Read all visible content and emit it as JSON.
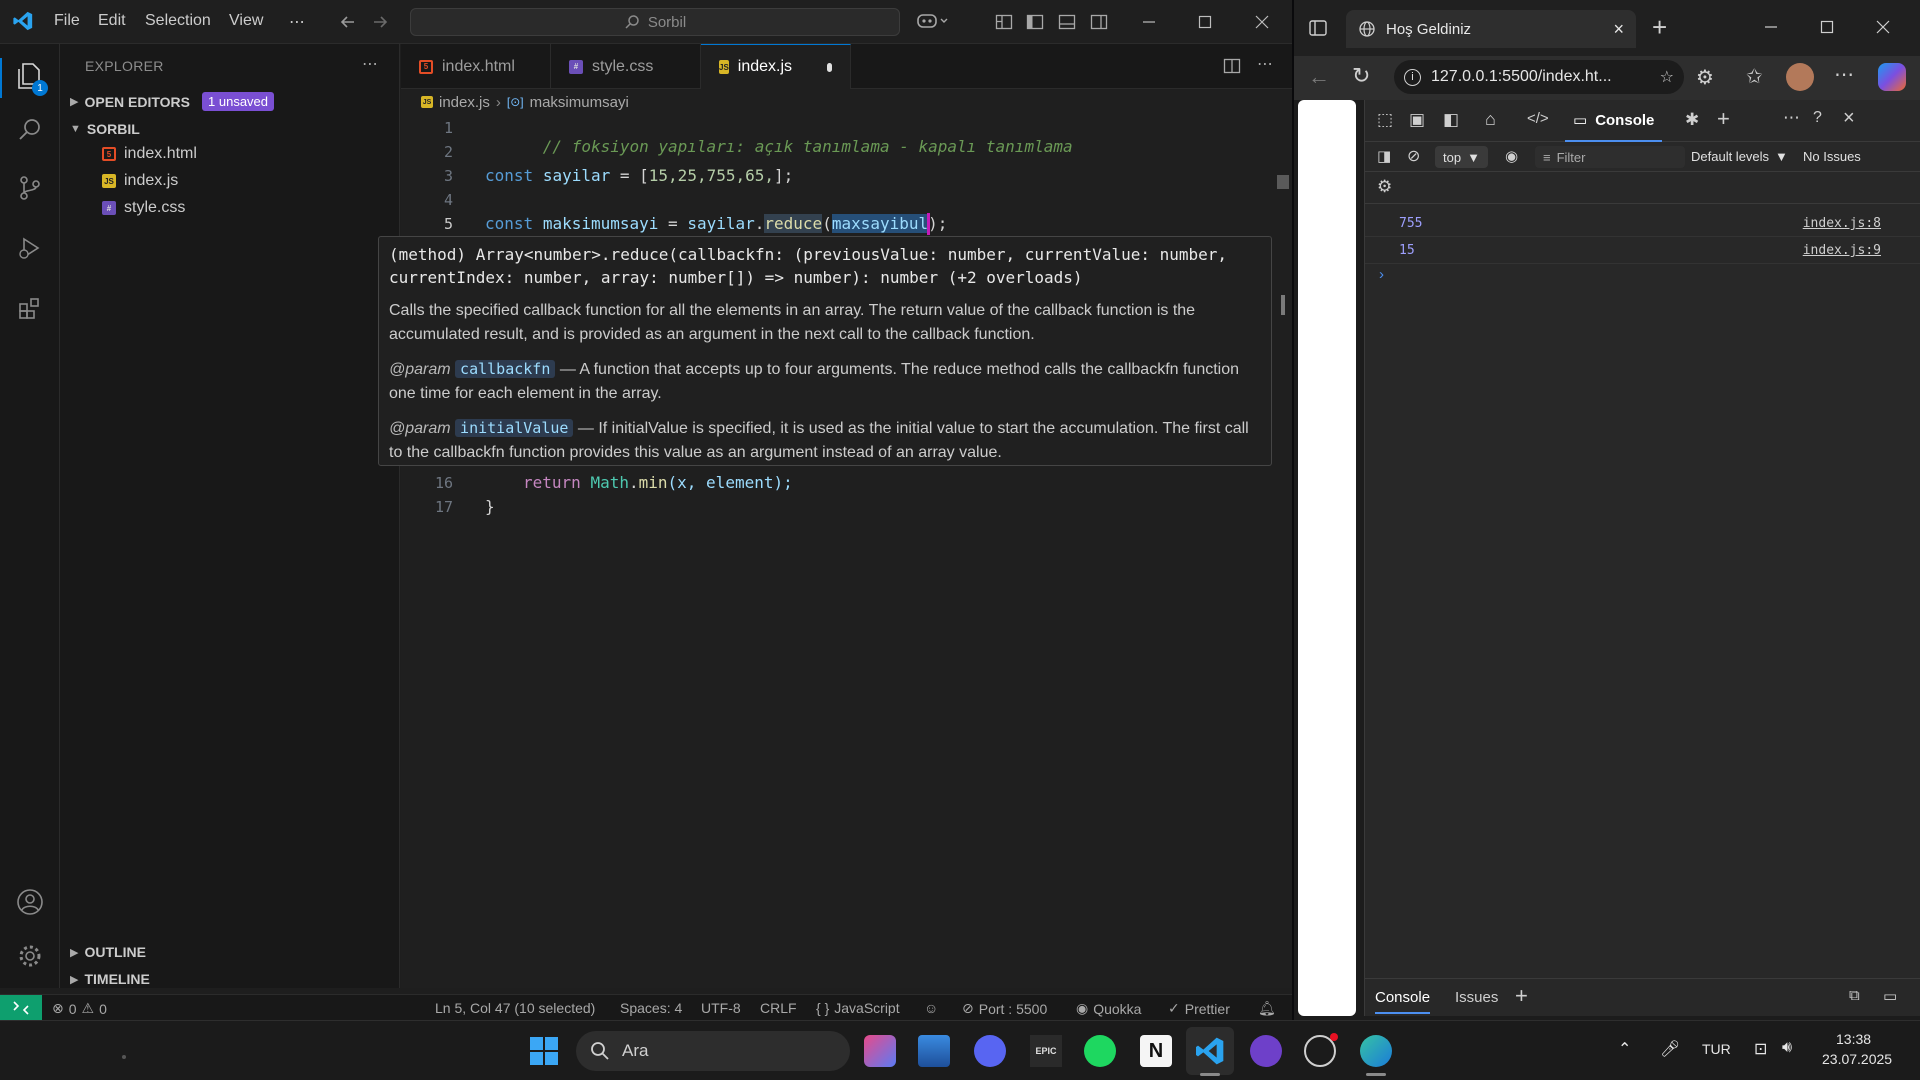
{
  "vscode": {
    "menu": [
      "File",
      "Edit",
      "Selection",
      "View",
      "⋯"
    ],
    "search_label": "Sorbil",
    "sidebar": {
      "title": "EXPLORER",
      "open_editors": "OPEN EDITORS",
      "unsaved_badge": "1 unsaved",
      "folder": "SORBIL",
      "files": [
        "index.html",
        "index.js",
        "style.css"
      ],
      "outline": "OUTLINE",
      "timeline": "TIMELINE"
    },
    "explorer_badge": "1",
    "tabs": [
      "index.html",
      "style.css",
      "index.js"
    ],
    "breadcrumb": {
      "file": "index.js",
      "symbol": "maksimumsayi"
    },
    "line_numbers": [
      "1",
      "2",
      "3",
      "4",
      "5",
      "16",
      "17"
    ],
    "code": {
      "l1": "// foksiyon yapıları: açık tanımlama - kapalı tanımlama",
      "l3_kw": "const",
      "l3_var": "sayilar",
      "l3_eq": " = [",
      "l3_nums": "15,25,755,65,",
      "l3_end": "];",
      "l5_kw": "const",
      "l5_var": "maksimumsayi",
      "l5_eq": " = ",
      "l5_obj": "sayilar",
      "l5_dot": ".",
      "l5_fn": "reduce",
      "l5_open": "(",
      "l5_arg": "maxsayibul",
      "l5_close": ");",
      "l16_kw": "return",
      "l16_cls": "Math",
      "l16_fn": "min",
      "l16_args": "(x, element);",
      "l17": "}"
    },
    "hover": {
      "sig1": "(method) Array<number>.reduce(callbackfn: (previousValue: number, currentValue: number,",
      "sig2": "currentIndex: number, array: number[]) => number): number (+2 overloads)",
      "desc": "Calls the specified callback function for all the elements in an array. The return value of the callback function is the accumulated result, and is provided as an argument in the next call to the callback function.",
      "param_tag": "@param",
      "param1_name": "callbackfn",
      "param1_desc": "— A function that accepts up to four arguments. The reduce method calls the callbackfn function one time for each element in the array.",
      "param2_name": "initialValue",
      "param2_desc": "— If initialValue is specified, it is used as the initial value to start the accumulation. The first call to the callbackfn function provides this value as an argument instead of an array value."
    },
    "status": {
      "errors": "0",
      "warnings": "0",
      "position": "Ln 5, Col 47 (10 selected)",
      "spaces": "Spaces: 4",
      "encoding": "UTF-8",
      "eol": "CRLF",
      "language": "JavaScript",
      "port": "Port : 5500",
      "quokka": "Quokka",
      "prettier": "Prettier"
    }
  },
  "edge": {
    "tab_title": "Hoş Geldiniz",
    "url": "127.0.0.1:5500/index.ht...",
    "devtools": {
      "active_tab": "Console",
      "context": "top",
      "filter_placeholder": "Filter",
      "levels": "Default levels",
      "issues": "No Issues",
      "logs": [
        {
          "value": "755",
          "source": "index.js:8"
        },
        {
          "value": "15",
          "source": "index.js:9"
        }
      ],
      "bottom_tabs": [
        "Console",
        "Issues"
      ]
    }
  },
  "taskbar": {
    "search": "Ara",
    "lang": "TUR",
    "time": "13:38",
    "date": "23.07.2025"
  },
  "colors": {
    "vscode_bg": "#1f1f1f",
    "accent": "#0078d4",
    "unsaved_badge": "#7a4fd3",
    "console_value": "#9d9ffd"
  }
}
